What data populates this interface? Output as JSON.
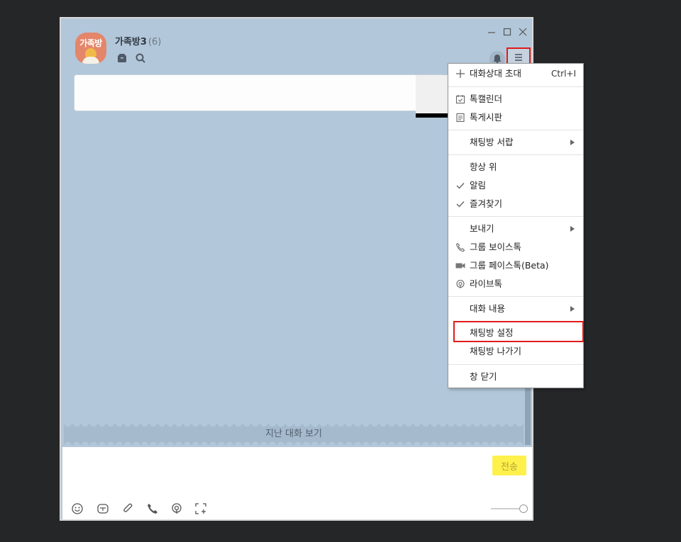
{
  "header": {
    "avatar_text": "가족방",
    "room_name": "가족방3",
    "member_count": "(6)"
  },
  "divider": {
    "label": "지난 대화 보기"
  },
  "input": {
    "send_label": "전송"
  },
  "menu": {
    "items": [
      {
        "label": "대화상대 초대",
        "shortcut": "Ctrl+I",
        "icon": "plus-icon"
      },
      {
        "label": "톡캘린더",
        "icon": "calendar-icon"
      },
      {
        "label": "톡게시판",
        "icon": "board-icon"
      },
      {
        "label": "채팅방 서랍",
        "submenu": true
      },
      {
        "label": "항상 위"
      },
      {
        "label": "알림",
        "checked": true
      },
      {
        "label": "즐겨찾기",
        "checked": true
      },
      {
        "label": "보내기",
        "submenu": true
      },
      {
        "label": "그룹 보이스톡",
        "icon": "phone-icon"
      },
      {
        "label": "그룹 페이스톡(Beta)",
        "icon": "video-icon"
      },
      {
        "label": "라이브톡",
        "icon": "live-icon"
      },
      {
        "label": "대화 내용",
        "submenu": true
      },
      {
        "label": "채팅방 설정"
      },
      {
        "label": "채팅방 나가기"
      },
      {
        "label": "창 닫기"
      }
    ]
  },
  "colors": {
    "chat_bg": "#b2c7da",
    "highlight": "#e01b1b",
    "send_button": "#fef14b"
  }
}
